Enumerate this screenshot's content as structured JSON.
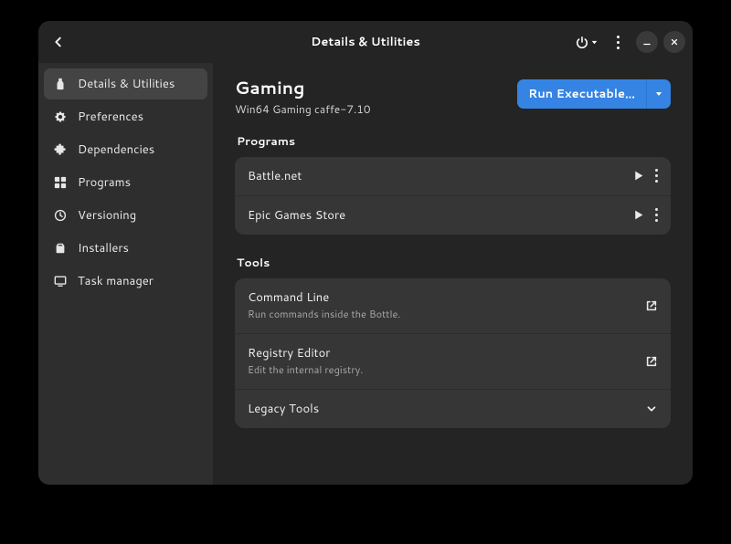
{
  "header": {
    "title": "Details & Utilities"
  },
  "sidebar": {
    "items": [
      {
        "icon": "bottle",
        "label": "Details & Utilities"
      },
      {
        "icon": "gear",
        "label": "Preferences"
      },
      {
        "icon": "puzzle",
        "label": "Dependencies"
      },
      {
        "icon": "grid",
        "label": "Programs"
      },
      {
        "icon": "clock",
        "label": "Versioning"
      },
      {
        "icon": "installer",
        "label": "Installers"
      },
      {
        "icon": "monitor",
        "label": "Task manager"
      }
    ]
  },
  "main": {
    "title": "Gaming",
    "subtitle": "Win64  Gaming  caffe-7.10",
    "run_button": "Run Executable…",
    "sections": {
      "programs": {
        "label": "Programs",
        "items": [
          {
            "name": "Battle.net"
          },
          {
            "name": "Epic Games Store"
          }
        ]
      },
      "tools": {
        "label": "Tools",
        "items": [
          {
            "name": "Command Line",
            "desc": "Run commands inside the Bottle."
          },
          {
            "name": "Registry Editor",
            "desc": "Edit the internal registry."
          },
          {
            "name": "Legacy Tools"
          }
        ]
      }
    }
  }
}
